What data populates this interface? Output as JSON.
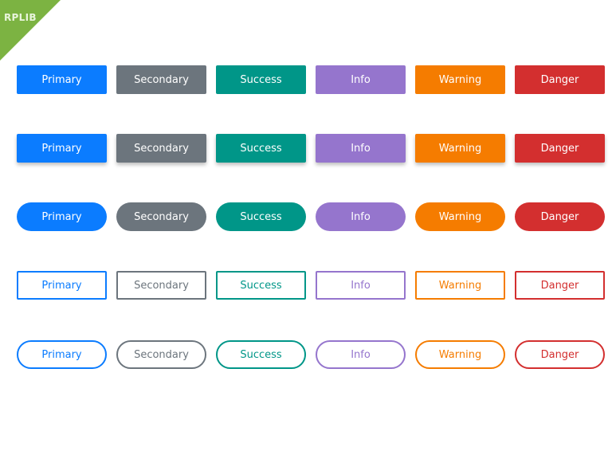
{
  "badge": {
    "label": "RPLIB",
    "color": "#7cb342"
  },
  "variants": [
    {
      "name": "primary",
      "label": "Primary",
      "color": "#0b7cff"
    },
    {
      "name": "secondary",
      "label": "Secondary",
      "color": "#6c757d"
    },
    {
      "name": "success",
      "label": "Success",
      "color": "#009688"
    },
    {
      "name": "info",
      "label": "Info",
      "color": "#9575cd"
    },
    {
      "name": "warning",
      "label": "Warning",
      "color": "#f57c00"
    },
    {
      "name": "danger",
      "label": "Danger",
      "color": "#d32f2f"
    }
  ],
  "rows": [
    {
      "style": "solid"
    },
    {
      "style": "raised"
    },
    {
      "style": "pill"
    },
    {
      "style": "outline"
    },
    {
      "style": "outline-pill"
    }
  ]
}
